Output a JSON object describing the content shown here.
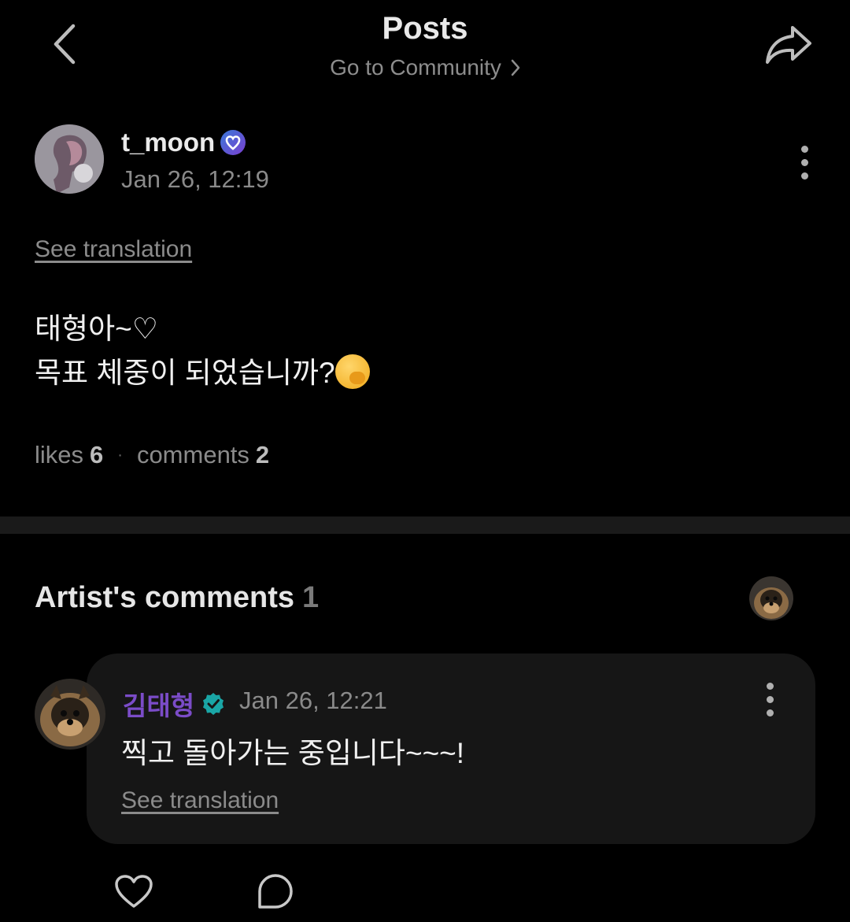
{
  "header": {
    "title": "Posts",
    "subtitle": "Go to Community",
    "back_icon": "chevron-left-icon",
    "share_icon": "share-arrow-icon"
  },
  "post": {
    "author": "t_moon",
    "time": "Jan 26, 12:19",
    "see_translation": "See translation",
    "line1": "태형아~♡",
    "line2": "목표 체중이 되었습니까?",
    "emoji": "hand-over-mouth-emoji",
    "likes_label": "likes",
    "likes_count": "6",
    "comments_label": "comments",
    "comments_count": "2",
    "separator": "·"
  },
  "artist_comments": {
    "title": "Artist's comments",
    "count": "1"
  },
  "comment": {
    "author": "김태형",
    "time": "Jan 26, 12:21",
    "text": "찍고 돌아가는 중입니다~~~!",
    "see_translation": "See translation"
  },
  "colors": {
    "background": "#000000",
    "artist_name": "#7b4cc8",
    "verified_badge": "#1aa6a6",
    "card_bg": "#161616"
  }
}
